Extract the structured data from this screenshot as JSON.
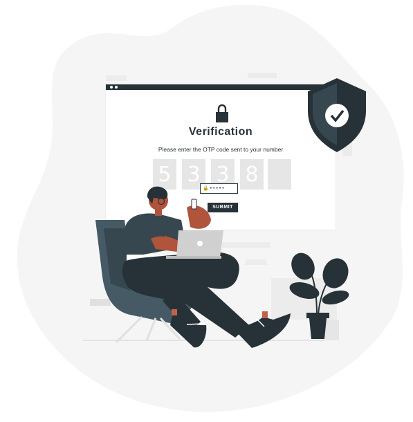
{
  "verification_card": {
    "title": "Verification",
    "instructions": "Please enter the OTP code sent to your number",
    "otp_digits": [
      "5",
      "3",
      "3",
      "8",
      ""
    ],
    "password_mask": "🔒 • • • • •",
    "submit_label": "SUBMIT"
  },
  "icons": {
    "padlock": "lock-icon",
    "shield": "shield-check-icon"
  },
  "colors": {
    "dark": "#263238",
    "skin": "#b0543c",
    "accent_red": "#c0634a",
    "blob": "#f5f5f5",
    "otp_box": "#e6e6e6"
  }
}
